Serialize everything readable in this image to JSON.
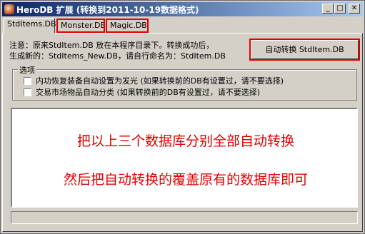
{
  "window": {
    "title": "HeroDB 扩展 (转换到2011-10-19数据格式)",
    "buttons": {
      "minimize": "_",
      "maximize": "□",
      "close": "✕"
    }
  },
  "tabs": [
    {
      "label": "StdItems.DB",
      "active": true
    },
    {
      "label": "Monster.DB",
      "active": false
    },
    {
      "label": "Magic.DB",
      "active": false
    }
  ],
  "note": {
    "line1": "注意：原来StdItem.DB 放在本程序目录下。转换成功后，",
    "line2": "生成新的：StdItems_New.DB，请自行命名为：StdItem.DB"
  },
  "convert_button": "自动转换 StdItem.DB",
  "options": {
    "group_label": "选项",
    "items": [
      {
        "label": "内功恢复装备自动设置为发光 (如果转换前的DB有设置过，请不要选择)",
        "checked": false
      },
      {
        "label": "交易市场物品自动分类 (如果转换前的DB有设置过，请不要选择)",
        "checked": false
      }
    ]
  },
  "annotation": {
    "line1": "把以上三个数据库分别全部自动转换",
    "line2": "然后把自动转换的覆盖原有的数据库即可"
  },
  "colors": {
    "titlebar_start": "#0a246a",
    "titlebar_end": "#a6caf0",
    "highlight_red": "#e00000",
    "face": "#d4d0c8"
  }
}
